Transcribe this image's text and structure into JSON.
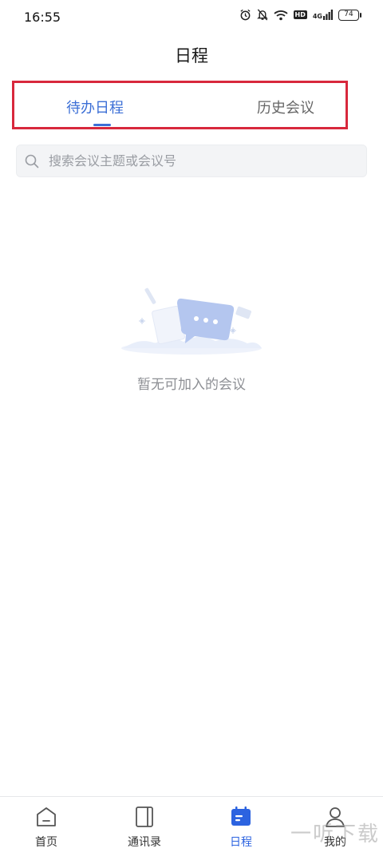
{
  "status_bar": {
    "time": "16:55",
    "network": "4G",
    "hd": "HD",
    "battery": "74",
    "icons": [
      "alarm-icon",
      "mute-icon",
      "wifi-icon",
      "hd-icon",
      "signal-icon",
      "battery-icon"
    ]
  },
  "header": {
    "title": "日程"
  },
  "tabs": [
    {
      "label": "待办日程",
      "active": true
    },
    {
      "label": "历史会议",
      "active": false
    }
  ],
  "search": {
    "placeholder": "搜索会议主题或会议号",
    "value": ""
  },
  "empty_state": {
    "text": "暂无可加入的会议"
  },
  "bottom_nav": [
    {
      "label": "首页",
      "icon": "home-icon",
      "active": false
    },
    {
      "label": "通讯录",
      "icon": "contacts-icon",
      "active": false
    },
    {
      "label": "日程",
      "icon": "calendar-icon",
      "active": true
    },
    {
      "label": "我的",
      "icon": "profile-icon",
      "active": false
    }
  ],
  "watermark": "一听下载",
  "colors": {
    "accent": "#3c6fd6",
    "highlight_box": "#d8283c",
    "active_nav": "#2c63e0"
  }
}
